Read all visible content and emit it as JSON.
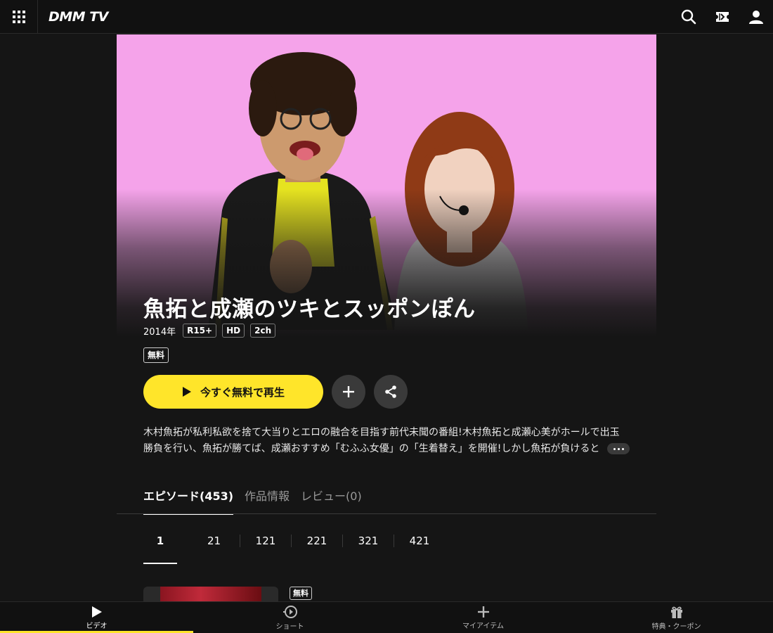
{
  "header": {
    "logo": "DMM TV"
  },
  "title": {
    "name": "魚拓と成瀬のツキとスッポンぽん",
    "year": "2014年",
    "badges": [
      "R15+",
      "HD",
      "2ch"
    ],
    "free_label": "無料"
  },
  "actions": {
    "play_label": "今すぐ無料で再生"
  },
  "description": {
    "line1": "木村魚拓が私利私欲を捨て大当りとエロの融合を目指す前代未聞の番組!木村魚拓と成瀬心美がホールで出玉",
    "line2": "勝負を行い、魚拓が勝てば、成瀬おすすめ「むふふ女優」の「生着替え」を開催!しかし魚拓が負けると"
  },
  "tabs": [
    {
      "label": "エピソード(453)"
    },
    {
      "label": "作品情報"
    },
    {
      "label": "レビュー(0)"
    }
  ],
  "pages": [
    "1",
    "21",
    "121",
    "221",
    "321",
    "421"
  ],
  "episode": {
    "free_label": "無料"
  },
  "bottom_nav": [
    {
      "label": "ビデオ"
    },
    {
      "label": "ショート"
    },
    {
      "label": "マイアイテム"
    },
    {
      "label": "特典・クーポン"
    }
  ],
  "colors": {
    "accent": "#ffe52a",
    "hero_background": "#f5a3ea",
    "background": "#151515"
  }
}
